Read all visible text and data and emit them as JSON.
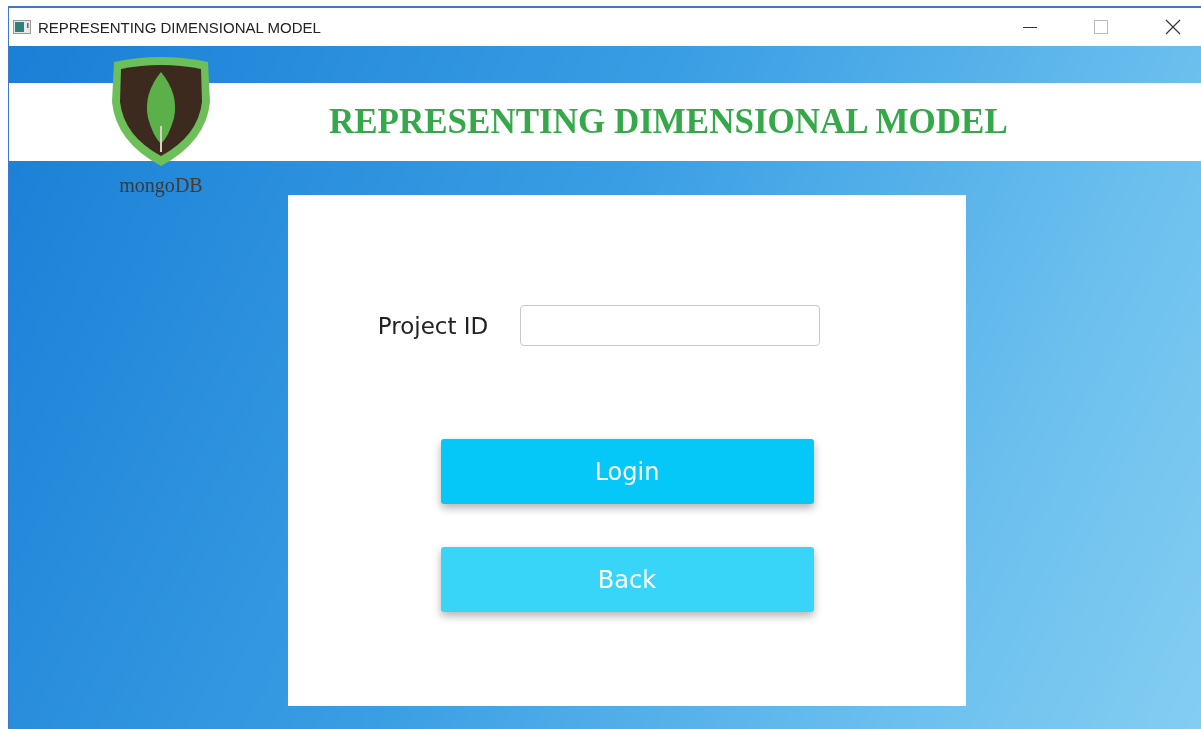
{
  "window": {
    "title": "REPRESENTING DIMENSIONAL MODEL"
  },
  "logo": {
    "text_parts": [
      "mongo",
      "DB"
    ]
  },
  "banner": {
    "title": "REPRESENTING DIMENSIONAL MODEL"
  },
  "form": {
    "field_label": "Project ID",
    "buttons": [
      {
        "label": "Login",
        "color": "#06c8f8"
      },
      {
        "label": "Back",
        "color": "#38d5f9"
      }
    ]
  }
}
